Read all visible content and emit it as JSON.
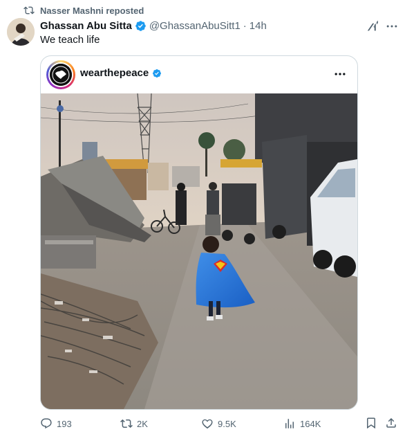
{
  "repost": {
    "text": "Nasser Mashni reposted"
  },
  "post": {
    "author_name": "Ghassan Abu Sitta",
    "handle": "@GhassanAbuSitt1",
    "separator": "·",
    "time": "14h",
    "text": "We teach life"
  },
  "embed": {
    "account": "wearthepeace",
    "logo_text": "WEAR THE PEACE"
  },
  "actions": {
    "replies": "193",
    "reposts": "2K",
    "likes": "9.5K",
    "views": "164K"
  },
  "colors": {
    "verified": "#1d9bf0",
    "muted": "#536471",
    "border": "#cfd9de"
  },
  "icons": [
    "repost-icon",
    "verified-icon",
    "grok-icon",
    "more-icon",
    "reply-icon",
    "like-icon",
    "views-icon",
    "bookmark-icon",
    "share-icon"
  ]
}
